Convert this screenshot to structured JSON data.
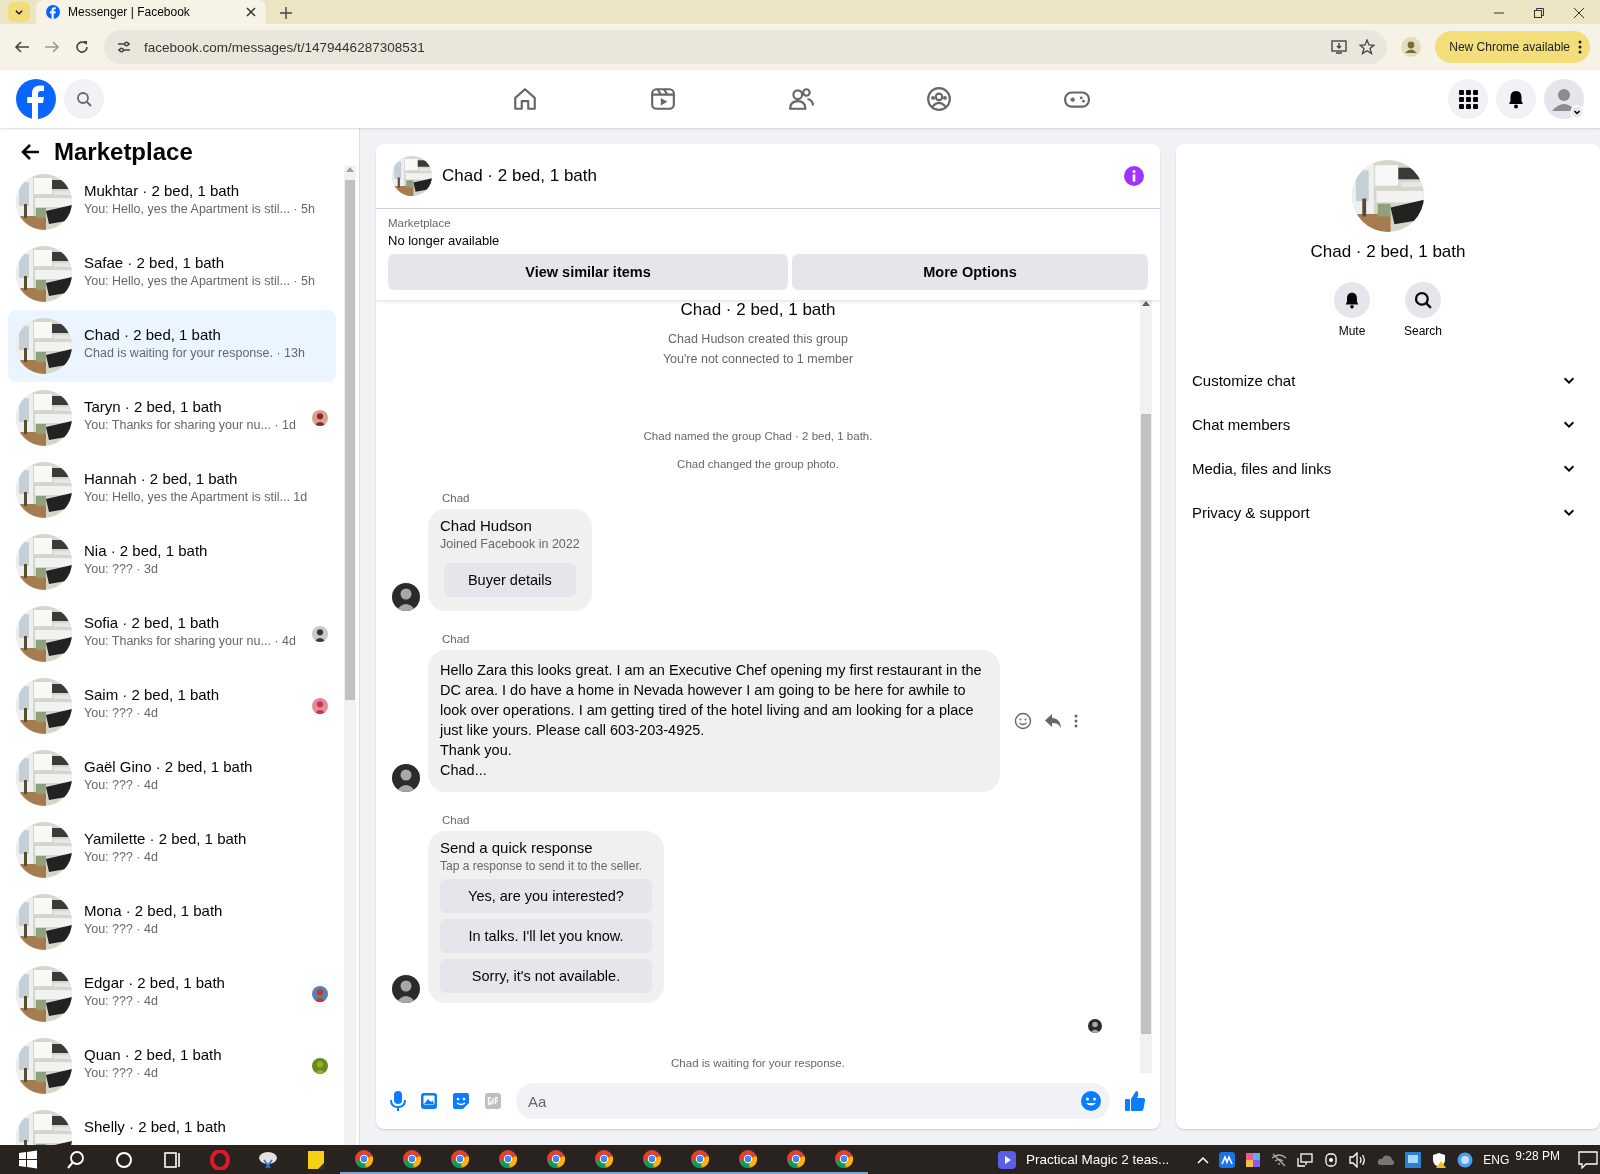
{
  "browser": {
    "tabs": [
      {
        "title": "Messenger | Facebook",
        "selected": true
      }
    ],
    "url": "facebook.com/messages/t/1479446287308531",
    "update_button": "New Chrome available"
  },
  "sidebar": {
    "title": "Marketplace",
    "conversations": [
      {
        "name": "Mukhtar · 2 bed, 1 bath",
        "preview": "You: Hello, yes the Apartment is stil... · 5h",
        "selected": false,
        "seen": false
      },
      {
        "name": "Safae · 2 bed, 1 bath",
        "preview": "You: Hello, yes the Apartment is stil... · 5h",
        "selected": false,
        "seen": false
      },
      {
        "name": "Chad · 2 bed, 1 bath",
        "preview": "Chad is waiting for your response. · 13h",
        "selected": true,
        "seen": false
      },
      {
        "name": "Taryn · 2 bed, 1 bath",
        "preview": "You: Thanks for sharing your nu...  · 1d",
        "selected": false,
        "seen": true
      },
      {
        "name": "Hannah · 2 bed, 1 bath",
        "preview": "You: Hello, yes the Apartment is stil... 1d",
        "selected": false,
        "seen": false
      },
      {
        "name": "Nia · 2 bed, 1 bath",
        "preview": "You: ??? · 3d",
        "selected": false,
        "seen": false
      },
      {
        "name": "Sofia · 2 bed, 1 bath",
        "preview": "You: Thanks for sharing your nu...  · 4d",
        "selected": false,
        "seen": true
      },
      {
        "name": "Saim · 2 bed, 1 bath",
        "preview": "You: ??? · 4d",
        "selected": false,
        "seen": true
      },
      {
        "name": "Gaël Gino · 2 bed, 1 bath",
        "preview": "You: ??? · 4d",
        "selected": false,
        "seen": false
      },
      {
        "name": "Yamilette · 2 bed, 1 bath",
        "preview": "You: ??? · 4d",
        "selected": false,
        "seen": false
      },
      {
        "name": "Mona · 2 bed, 1 bath",
        "preview": "You: ??? · 4d",
        "selected": false,
        "seen": false
      },
      {
        "name": "Edgar · 2 bed, 1 bath",
        "preview": "You: ??? · 4d",
        "selected": false,
        "seen": true
      },
      {
        "name": "Quan · 2 bed, 1 bath",
        "preview": "You: ??? · 4d",
        "selected": false,
        "seen": true
      },
      {
        "name": "Shelly · 2 bed, 1 bath",
        "selected": false,
        "seen": false
      }
    ]
  },
  "chat": {
    "title": "Chad · 2 bed, 1 bath",
    "listing": {
      "label": "Marketplace",
      "status": "No longer available",
      "buttons": [
        "View similar items",
        "More Options"
      ]
    },
    "messages": [
      {
        "kind": "group_title",
        "text": "Chad · 2 bed, 1 bath"
      },
      {
        "kind": "notice",
        "text": "Chad Hudson created this group"
      },
      {
        "kind": "notice",
        "text": "You're not connected to 1 member"
      },
      {
        "kind": "event",
        "text": "Chad named the group Chad · 2 bed, 1 bath."
      },
      {
        "kind": "event",
        "text": "Chad changed the group photo."
      },
      {
        "kind": "profile",
        "sender": "Chad",
        "name": "Chad Hudson",
        "detail": "Joined Facebook in 2022",
        "button": "Buyer details"
      },
      {
        "kind": "text",
        "sender": "Chad",
        "lines": [
          "Hello Zara this looks great. I am an Executive Chef opening my first restaurant in the DC area. I do have a home in Nevada however I am going to be here for awhile to look over operations. I am getting tired of the hotel living and am looking for a place just like yours. Please call 603-203-4925.",
          "Thank you.",
          "Chad..."
        ]
      },
      {
        "kind": "quick_reply",
        "sender": "Chad",
        "title": "Send a quick response",
        "subtitle": "Tap a response to send it to the seller.",
        "options": [
          "Yes, are you interested?",
          "In talks. I'll let you know.",
          "Sorry, it's not available."
        ]
      },
      {
        "kind": "seen"
      },
      {
        "kind": "status",
        "text": "Chad is waiting for your response."
      }
    ],
    "composer": {
      "placeholder": "Aa"
    }
  },
  "details": {
    "title": "Chad · 2 bed, 1 bath",
    "actions": [
      {
        "kind": "mute",
        "label": "Mute"
      },
      {
        "kind": "search",
        "label": "Search"
      }
    ],
    "sections": [
      {
        "label": "Customize chat",
        "expanded": false
      },
      {
        "label": "Chat members",
        "expanded": false
      },
      {
        "label": "Media, files and links",
        "expanded": false
      },
      {
        "label": "Privacy & support",
        "expanded": false
      }
    ]
  },
  "taskbar": {
    "apps": [
      {
        "kind": "start"
      },
      {
        "kind": "search"
      },
      {
        "kind": "cortana"
      },
      {
        "kind": "taskview"
      },
      {
        "kind": "opera"
      },
      {
        "kind": "snip"
      },
      {
        "kind": "notes"
      },
      {
        "kind": "chrome"
      },
      {
        "kind": "chrome"
      },
      {
        "kind": "chrome"
      },
      {
        "kind": "chrome"
      },
      {
        "kind": "chrome"
      },
      {
        "kind": "chrome"
      },
      {
        "kind": "chrome"
      },
      {
        "kind": "chrome"
      },
      {
        "kind": "chrome"
      },
      {
        "kind": "chrome"
      },
      {
        "kind": "chrome"
      }
    ],
    "task": "Practical Magic 2 teas...",
    "language": "ENG",
    "time": "9:28 PM"
  }
}
